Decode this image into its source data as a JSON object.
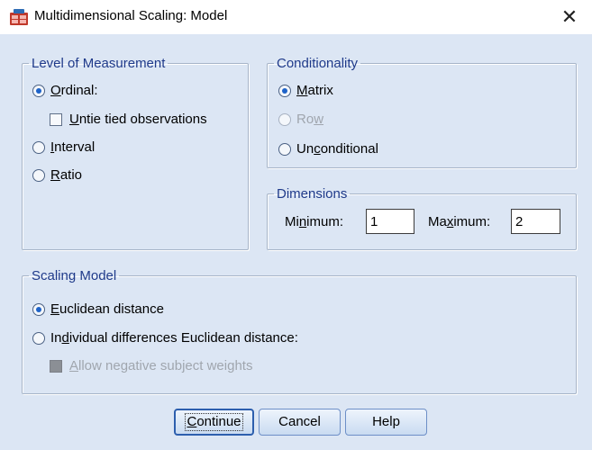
{
  "window": {
    "title": "Multidimensional Scaling: Model",
    "close_icon": "close-icon",
    "app_icon": "spss-dialog-icon"
  },
  "level_of_measurement": {
    "legend": "Level of Measurement",
    "ordinal": {
      "prefix": "",
      "accel": "O",
      "suffix": "rdinal:",
      "selected": true
    },
    "untie": {
      "prefix": "",
      "accel": "U",
      "suffix": "ntie tied observations",
      "checked": false
    },
    "interval": {
      "prefix": "",
      "accel": "I",
      "suffix": "nterval",
      "selected": false
    },
    "ratio": {
      "prefix": "",
      "accel": "R",
      "suffix": "atio",
      "selected": false
    }
  },
  "conditionality": {
    "legend": "Conditionality",
    "matrix": {
      "prefix": "",
      "accel": "M",
      "suffix": "atrix",
      "selected": true
    },
    "row": {
      "prefix": "Ro",
      "accel": "w",
      "suffix": "",
      "selected": false,
      "disabled": true
    },
    "unconditional": {
      "prefix": "Un",
      "accel": "c",
      "suffix": "onditional",
      "selected": false
    }
  },
  "dimensions": {
    "legend": "Dimensions",
    "minimum": {
      "prefix": "Mi",
      "accel": "n",
      "suffix": "imum:",
      "value": "1"
    },
    "maximum": {
      "prefix": "Ma",
      "accel": "x",
      "suffix": "imum:",
      "value": "2"
    }
  },
  "scaling_model": {
    "legend": "Scaling Model",
    "euclidean": {
      "prefix": "",
      "accel": "E",
      "suffix": "uclidean distance",
      "selected": true
    },
    "individual": {
      "prefix": "In",
      "accel": "d",
      "suffix": "ividual differences Euclidean distance:",
      "selected": false
    },
    "allow_negative": {
      "prefix": "",
      "accel": "A",
      "suffix": "llow negative subject weights",
      "checked": false,
      "disabled": true
    }
  },
  "buttons": {
    "continue": {
      "prefix": "",
      "accel": "C",
      "suffix": "ontinue"
    },
    "cancel": "Cancel",
    "help": "Help"
  },
  "colors": {
    "dialog_background": "#dce6f4",
    "legend_text": "#1f3a8a",
    "radio_selected": "#1e63c9",
    "button_border": "#6d8fc7"
  }
}
